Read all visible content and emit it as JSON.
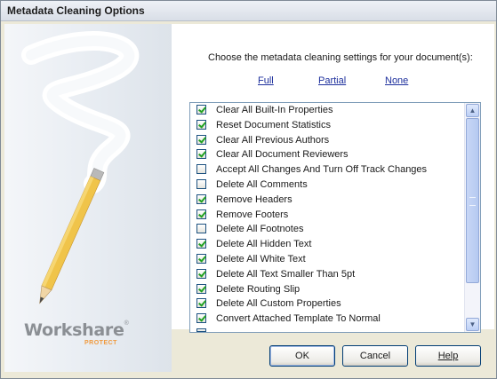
{
  "window": {
    "title": "Metadata Cleaning Options"
  },
  "prompt": "Choose the metadata cleaning settings for your document(s):",
  "quick_select": {
    "full": "Full",
    "partial": "Partial",
    "none": "None"
  },
  "options": [
    {
      "label": "Clear All Built-In Properties",
      "checked": true
    },
    {
      "label": "Reset Document Statistics",
      "checked": true
    },
    {
      "label": "Clear All Previous Authors",
      "checked": true
    },
    {
      "label": "Clear All Document Reviewers",
      "checked": true
    },
    {
      "label": "Accept All Changes And Turn Off Track Changes",
      "checked": false
    },
    {
      "label": "Delete All Comments",
      "checked": false
    },
    {
      "label": "Remove Headers",
      "checked": true
    },
    {
      "label": "Remove Footers",
      "checked": true
    },
    {
      "label": "Delete All Footnotes",
      "checked": false
    },
    {
      "label": "Delete All Hidden Text",
      "checked": true
    },
    {
      "label": "Delete All White Text",
      "checked": true
    },
    {
      "label": "Delete All Text Smaller Than 5pt",
      "checked": true
    },
    {
      "label": "Delete Routing Slip",
      "checked": true
    },
    {
      "label": "Delete All Custom Properties",
      "checked": true
    },
    {
      "label": "Convert Attached Template To Normal",
      "checked": true
    }
  ],
  "logo": {
    "name": "Workshare",
    "registered": "®",
    "product": "PROTECT"
  },
  "buttons": {
    "ok": "OK",
    "cancel": "Cancel",
    "help": "Help"
  },
  "colors": {
    "link": "#1d2f9c",
    "checkmark": "#21a121",
    "logo_accent": "#f09a3e",
    "dialog_background": "#ece9d8"
  },
  "icons": {
    "scroll_up": "scroll-up-arrow-icon",
    "scroll_down": "scroll-down-arrow-icon",
    "pencil": "pencil-illustration"
  }
}
